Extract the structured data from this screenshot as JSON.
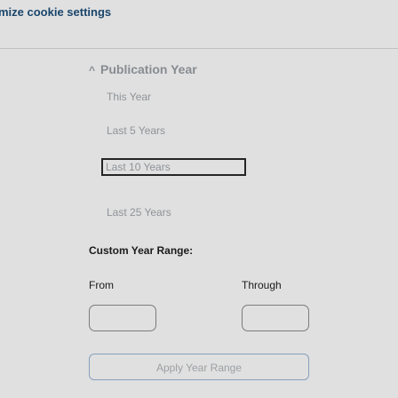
{
  "cookie": {
    "link_label": "mize cookie settings"
  },
  "facet": {
    "caret_icon": "^",
    "title": "Publication Year",
    "options": [
      "This Year",
      "Last 5 Years",
      "Last 10 Years",
      "Last 25 Years"
    ],
    "selected_index": 2
  },
  "custom_range": {
    "title": "Custom Year Range:",
    "from_label": "From",
    "through_label": "Through",
    "from_value": "",
    "through_value": "",
    "apply_label": "Apply Year Range"
  }
}
